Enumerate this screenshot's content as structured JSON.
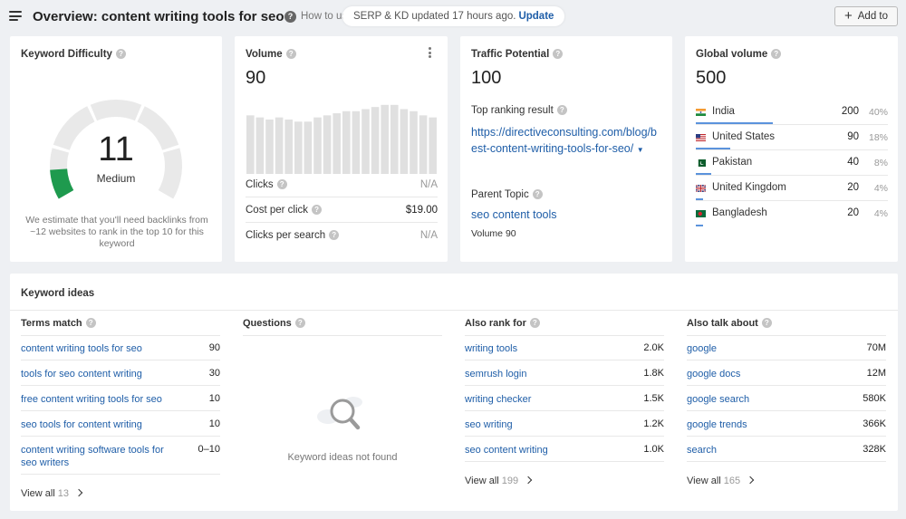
{
  "header": {
    "title": "Overview: content writing tools for seo",
    "how_to": "How to use",
    "serp_notice": "SERP & KD updated 17 hours ago.",
    "update_label": "Update",
    "add_label": "Add to"
  },
  "kd": {
    "title": "Keyword Difficulty",
    "value": "11",
    "level": "Medium",
    "score_fraction": 0.11,
    "gauge_color": "#1e9a4e",
    "description": "We estimate that you'll need backlinks from ~12 websites to rank in the top 10 for this keyword"
  },
  "volume": {
    "title": "Volume",
    "value": "90",
    "trend": [
      28,
      27,
      26,
      27,
      26,
      25,
      25,
      27,
      28,
      29,
      30,
      30,
      31,
      32,
      33,
      33,
      31,
      30,
      28,
      27
    ],
    "bar_color": "#e0e0e0",
    "rows": [
      {
        "label": "Clicks",
        "value": "N/A"
      },
      {
        "label": "Cost per click",
        "value": "$19.00"
      },
      {
        "label": "Clicks per search",
        "value": "N/A"
      }
    ]
  },
  "tp": {
    "title": "Traffic Potential",
    "value": "100",
    "top_result_label": "Top ranking result",
    "top_result_url": "https://directiveconsulting.com/blog/best-content-writing-tools-for-seo/",
    "parent_label": "Parent Topic",
    "parent_topic": "seo content tools",
    "parent_volume": "Volume 90"
  },
  "global": {
    "title": "Global volume",
    "value": "500",
    "countries": [
      {
        "name": "India",
        "value": "200",
        "pct": "40%",
        "share": 0.4,
        "flag": "india"
      },
      {
        "name": "United States",
        "value": "90",
        "pct": "18%",
        "share": 0.18,
        "flag": "us"
      },
      {
        "name": "Pakistan",
        "value": "40",
        "pct": "8%",
        "share": 0.08,
        "flag": "pakistan"
      },
      {
        "name": "United Kingdom",
        "value": "20",
        "pct": "4%",
        "share": 0.04,
        "flag": "uk"
      },
      {
        "name": "Bangladesh",
        "value": "20",
        "pct": "4%",
        "share": 0.04,
        "flag": "bangladesh"
      }
    ]
  },
  "ideas": {
    "title": "Keyword ideas",
    "terms": {
      "header": "Terms match",
      "items": [
        {
          "keyword": "content writing tools for seo",
          "value": "90"
        },
        {
          "keyword": "tools for seo content writing",
          "value": "30"
        },
        {
          "keyword": "free content writing tools for seo",
          "value": "10"
        },
        {
          "keyword": "seo tools for content writing",
          "value": "10"
        },
        {
          "keyword": "content writing software tools for seo writers",
          "value": "0–10"
        }
      ],
      "view_all": "View all",
      "count": "13"
    },
    "questions": {
      "header": "Questions",
      "empty_text": "Keyword ideas not found"
    },
    "also_rank": {
      "header": "Also rank for",
      "items": [
        {
          "keyword": "writing tools",
          "value": "2.0K"
        },
        {
          "keyword": "semrush login",
          "value": "1.8K"
        },
        {
          "keyword": "writing checker",
          "value": "1.5K"
        },
        {
          "keyword": "seo writing",
          "value": "1.2K"
        },
        {
          "keyword": "seo content writing",
          "value": "1.0K"
        }
      ],
      "view_all": "View all",
      "count": "199"
    },
    "also_talk": {
      "header": "Also talk about",
      "items": [
        {
          "keyword": "google",
          "value": "70M"
        },
        {
          "keyword": "google docs",
          "value": "12M"
        },
        {
          "keyword": "google search",
          "value": "580K"
        },
        {
          "keyword": "google trends",
          "value": "366K"
        },
        {
          "keyword": "search",
          "value": "328K"
        }
      ],
      "view_all": "View all",
      "count": "165"
    }
  }
}
